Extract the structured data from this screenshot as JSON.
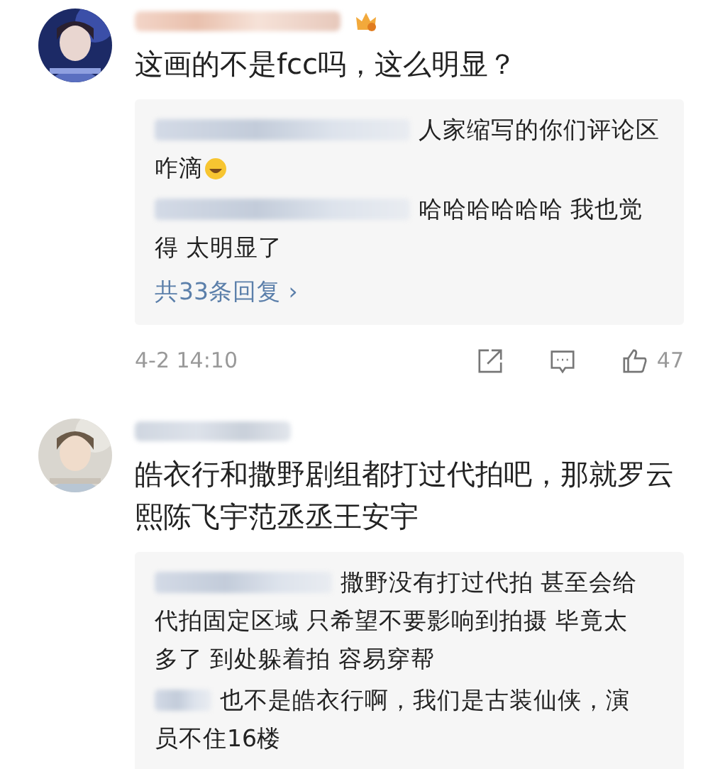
{
  "comments": [
    {
      "badge": true,
      "text": "这画的不是fcc吗，这么明显？",
      "replies": [
        {
          "lines": [
            "人家缩写的你们评论区",
            "咋滴"
          ],
          "emoji": true
        },
        {
          "lines": [
            "哈哈哈哈哈哈 我也觉",
            "得  太明显了"
          ],
          "emoji": false
        }
      ],
      "more_replies": "共33条回复 ›",
      "time": "4-2 14:10",
      "likes": "47"
    },
    {
      "badge": false,
      "text": "皓衣行和撒野剧组都打过代拍吧，那就罗云熙陈飞宇范丞丞王安宇",
      "replies": [
        {
          "lines": [
            "撒野没有打过代拍 甚至会给",
            "代拍固定区域 只希望不要影响到拍摄 毕竟太",
            "多了 到处躲着拍 容易穿帮"
          ],
          "emoji": false
        },
        {
          "lines": [
            "也不是皓衣行啊，我们是古装仙侠，演",
            "员不住16楼"
          ],
          "emoji": false
        }
      ]
    }
  ]
}
